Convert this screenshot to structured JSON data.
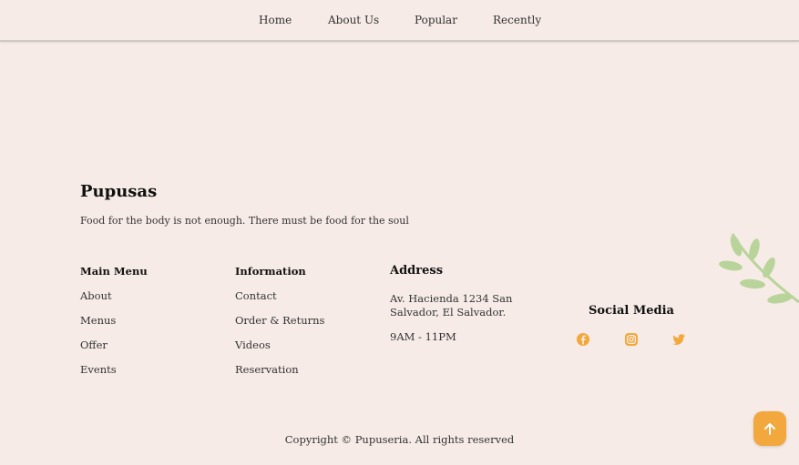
{
  "nav": {
    "items": [
      "Home",
      "About Us",
      "Popular",
      "Recently"
    ]
  },
  "footer": {
    "brand": "Pupusas",
    "tagline": "Food for the body is not enough. There must be food for the soul",
    "main_menu": {
      "title": "Main Menu",
      "links": [
        "About",
        "Menus",
        "Offer",
        "Events"
      ]
    },
    "information": {
      "title": "Information",
      "links": [
        "Contact",
        "Order & Returns",
        "Videos",
        "Reservation"
      ]
    },
    "address": {
      "title": "Address",
      "line1": "Av. Hacienda 1234 San Salvador, El Salvador.",
      "hours": "9AM - 11PM"
    },
    "social": {
      "title": "Social Media",
      "icons": [
        "facebook-icon",
        "instagram-icon",
        "twitter-icon"
      ]
    },
    "copyright": "Copyright © Pupuseria. All rights reserved"
  },
  "colors": {
    "background": "#f6ebe6",
    "accent": "#f2a83c",
    "leaf": "#b9d49a"
  }
}
